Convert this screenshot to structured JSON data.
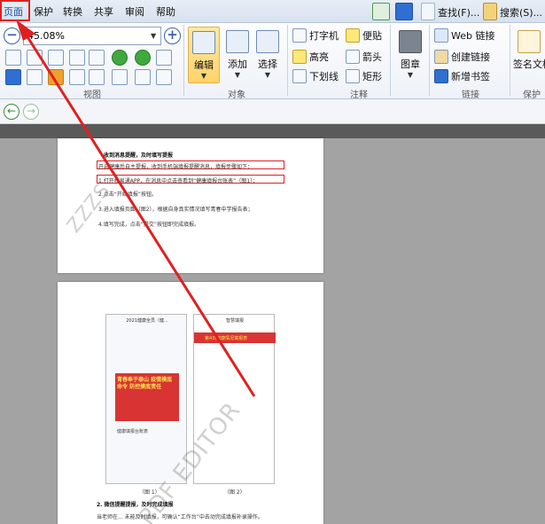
{
  "menu": {
    "items": [
      "页面",
      "保护",
      "转换",
      "共享",
      "审阅",
      "帮助"
    ],
    "active": "页面",
    "find_label": "查找(F)...",
    "search_label": "搜索(S)..."
  },
  "zoom": {
    "value": "45.08%"
  },
  "ribbon": {
    "groups": {
      "view": "视图",
      "object": "对象",
      "comment": "注释",
      "links": "链接",
      "protect": "保护"
    },
    "edit_label": "编辑",
    "add_label": "添加",
    "select_label": "选择",
    "typewriter_label": "打字机",
    "note_label": "便贴",
    "highlight_label": "高亮",
    "arrow_label": "箭头",
    "underline_label": "下划线",
    "rectangle_label": "矩形",
    "stamp_label": "图章",
    "web_link_label": "Web 链接",
    "create_link_label": "创建链接",
    "new_bookmark_label": "新增书签",
    "signature_label": "签名文档"
  },
  "document": {
    "page1": {
      "heading": "收到消息提醒，及时填写提报",
      "line1": "开启健康后自主提报，收到手机端填报提醒消息，填报步骤如下：",
      "line2": "1.打开校易通APP，在消息中点击查看到“健康填报台账表”（图1）；",
      "line3": "2.点击“开始填报”按钮。",
      "line4": "3.进入填报页面（图2），根据自身真实情况填写青春中学报告表；",
      "line5": "4.填写完成，点击“提交”按钮即完成填报。"
    },
    "page2": {
      "phone1_title": "2021健康全员（健...",
      "phone1_banner": "青春奉于泰山 疫情摸底命令 防控摸底责任",
      "phone1_msg": "健康填报台账表",
      "phone2_title": "智慧填报",
      "phone2_banner": "第4日健康情况填报表",
      "caption1": "（图 1）",
      "caption2": "（图 2）",
      "section2": "2. 微信提醒提报，及时完成填报",
      "section2_line": "当老师在... 未能及时填报，可确认“工作台”中去动完成填报补录操作。"
    },
    "watermark1": "ZZZS",
    "watermark2": "PDF EDITOR"
  },
  "colors": {
    "highlight_red": "#e02020",
    "accent_blue": "#2f6fd1"
  }
}
